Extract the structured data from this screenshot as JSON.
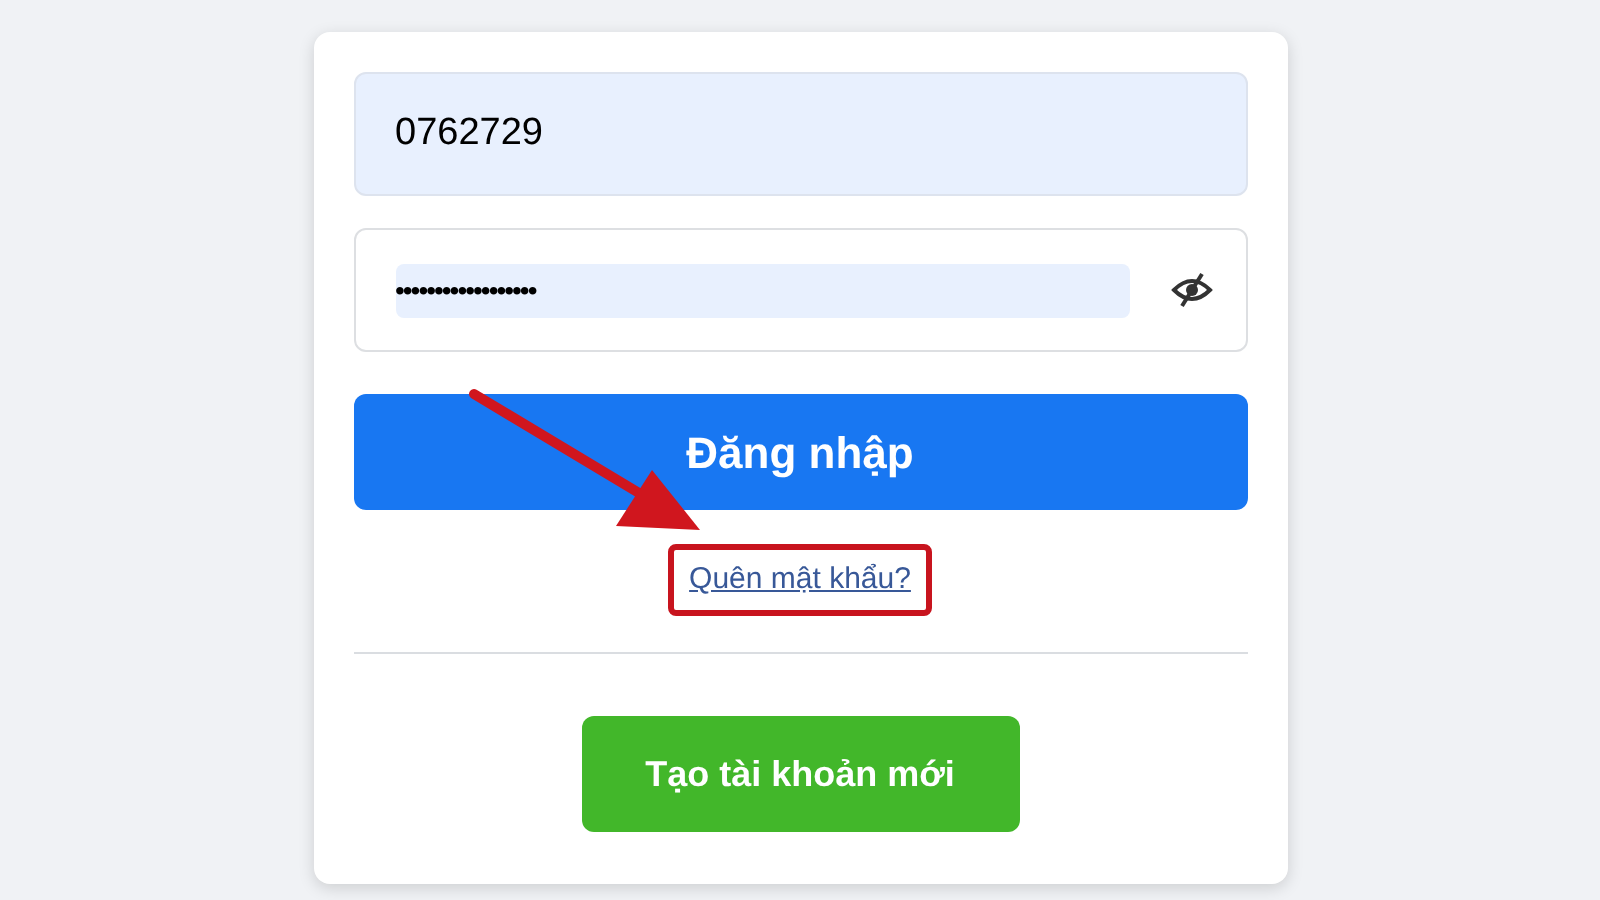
{
  "login_form": {
    "phone_field": {
      "value": "0762729",
      "autofilled": true
    },
    "password_field": {
      "value": "••••••••••••••••••",
      "autofilled": true,
      "show_password": false
    },
    "login_button": {
      "label": "Đăng nhập"
    },
    "forgot_link": {
      "label": "Quên mật khẩu?",
      "highlighted": true
    },
    "create_account_button": {
      "label": "Tạo tài khoản mới"
    }
  },
  "annotation": {
    "arrow": true
  }
}
